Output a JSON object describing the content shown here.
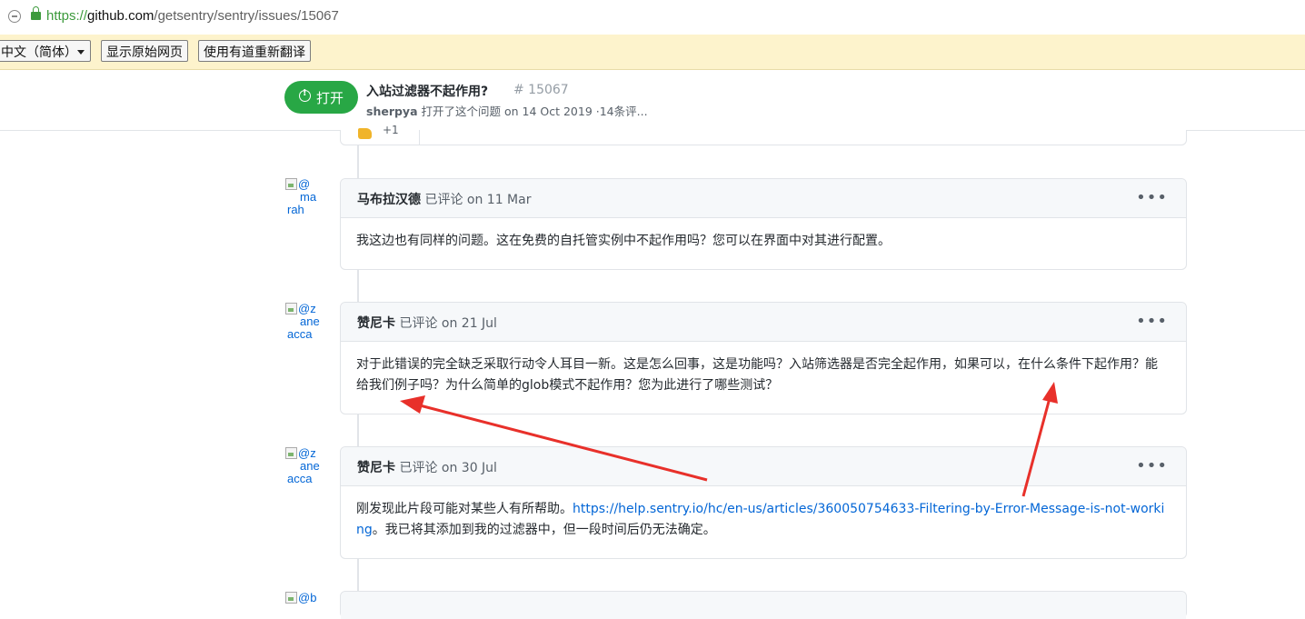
{
  "browser": {
    "url_scheme": "https://",
    "url_host": "github.com",
    "url_path": "/getsentry/sentry/issues/15067"
  },
  "translate_bar": {
    "language": "中文（简体）",
    "show_original": "显示原始网页",
    "retranslate": "使用有道重新翻译"
  },
  "issue": {
    "state": "打开",
    "title": "入站过滤器不起作用?",
    "number": "# 15067",
    "author": "sherpya",
    "meta_rest": " 打开了这个问题 on 14 Oct 2019 ·14条评..."
  },
  "prev_reaction": {
    "count": "+1"
  },
  "comments": [
    {
      "avatar_alt": "@marahab",
      "avatar_lines": [
        "@",
        "ma",
        "rah"
      ],
      "author": "马布拉汉德",
      "action": " 已评论 on 11 Mar",
      "body": "我这边也有同样的问题。这在免费的自托管实例中不起作用吗？您可以在界面中对其进行配置。"
    },
    {
      "avatar_alt": "@zaneacca",
      "avatar_lines": [
        "@z",
        "ane",
        "acca"
      ],
      "author": "赞尼卡",
      "action": " 已评论 on 21 Jul",
      "body": "对于此错误的完全缺乏采取行动令人耳目一新。这是怎么回事，这是功能吗？入站筛选器是否完全起作用，如果可以，在什么条件下起作用？能给我们例子吗？为什么简单的glob模式不起作用？您为此进行了哪些测试？"
    },
    {
      "avatar_alt": "@zaneacca",
      "avatar_lines": [
        "@z",
        "ane",
        "acca"
      ],
      "author": "赞尼卡",
      "action": " 已评论 on 30 Jul",
      "body_before": "刚发现此片段可能对某些人有所帮助。",
      "link": "https://help.sentry.io/hc/en-us/articles/360050754633-Filtering-by-Error-Message-is-not-working",
      "body_after": "。我已将其添加到我的过滤器中，但一段时间后仍无法确定。"
    }
  ],
  "next_avatar": "@b",
  "colors": {
    "open_green": "#28a745",
    "link_blue": "#0366d6",
    "annotation_red": "#e8302a",
    "translate_bar": "#fdf3cc"
  }
}
